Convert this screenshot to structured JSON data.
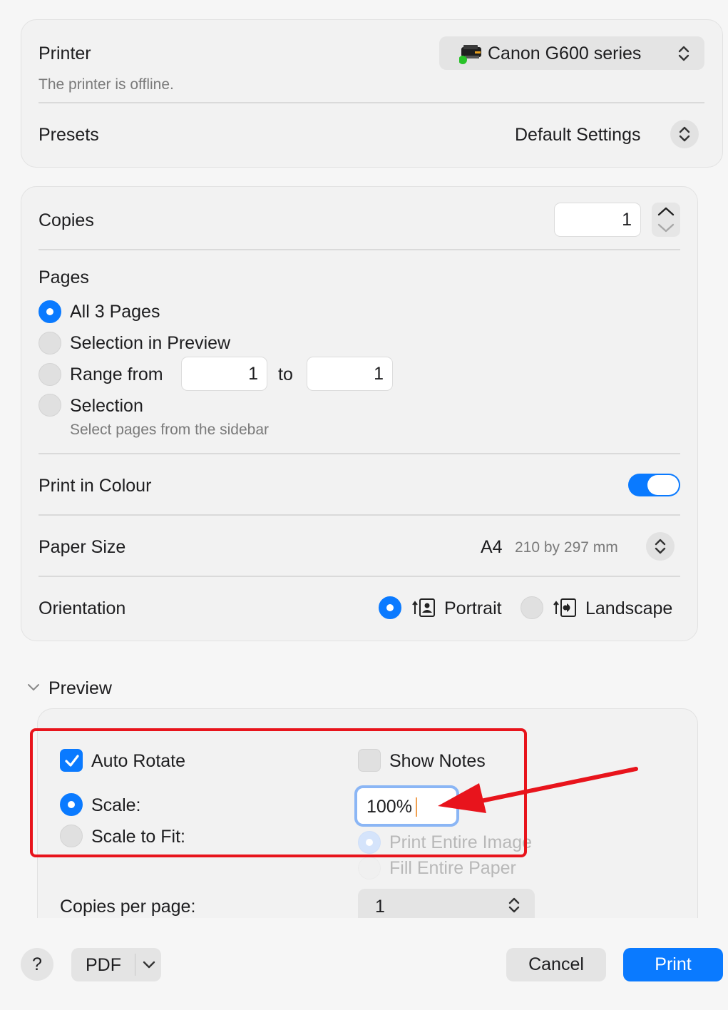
{
  "printer": {
    "label": "Printer",
    "status": "The printer is offline.",
    "selected": "Canon G600 series",
    "icon": "printer-icon"
  },
  "presets": {
    "label": "Presets",
    "selected": "Default Settings"
  },
  "copies": {
    "label": "Copies",
    "value": "1"
  },
  "pages": {
    "label": "Pages",
    "options": [
      {
        "label": "All 3 Pages",
        "selected": true
      },
      {
        "label": "Selection in Preview",
        "selected": false
      },
      {
        "label": "Range from",
        "selected": false
      },
      {
        "label": "Selection",
        "selected": false
      }
    ],
    "range_from": "1",
    "range_to_label": "to",
    "range_to": "1",
    "selection_hint": "Select pages from the sidebar"
  },
  "colour": {
    "label": "Print in Colour",
    "enabled": true
  },
  "paper": {
    "label": "Paper Size",
    "size": "A4",
    "dimensions": "210 by 297 mm"
  },
  "orientation": {
    "label": "Orientation",
    "portrait": "Portrait",
    "landscape": "Landscape",
    "selected": "Portrait"
  },
  "preview": {
    "label": "Preview",
    "auto_rotate": "Auto Rotate",
    "auto_rotate_checked": true,
    "show_notes": "Show Notes",
    "show_notes_checked": false,
    "scale": "Scale:",
    "scale_value": "100%",
    "scale_to_fit": "Scale to Fit:",
    "print_entire_image": "Print Entire Image",
    "fill_entire_paper": "Fill Entire Paper",
    "copies_per_page": "Copies per page:",
    "copies_per_page_value": "1"
  },
  "footer": {
    "help": "?",
    "pdf": "PDF",
    "cancel": "Cancel",
    "print": "Print"
  },
  "colors": {
    "accent": "#0a7aff",
    "annotation": "#e8141c",
    "offline_dot": "#28c228"
  }
}
